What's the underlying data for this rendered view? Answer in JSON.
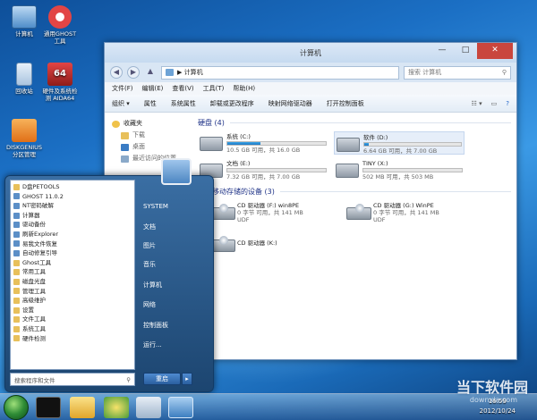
{
  "desktop": {
    "icons": [
      {
        "label": "计算机",
        "color": "#7aaee0"
      },
      {
        "label": "通用GHOST\n工具",
        "color": "#e24545"
      },
      {
        "label": "回收站",
        "color": "#c9dff3"
      },
      {
        "label": "硬件及系统检\n测 AIDA64",
        "color": "#c9312c"
      },
      {
        "label": "DISKGENIUS\n分区管理",
        "color": "#f08c2a"
      }
    ]
  },
  "window": {
    "title": "计算机",
    "nav": {
      "back": "◀",
      "forward": "▶",
      "up": "▲"
    },
    "address": "▶ 计算机",
    "search_placeholder": "搜索 计算机",
    "menu": [
      "文件(F)",
      "编辑(E)",
      "查看(V)",
      "工具(T)",
      "帮助(H)"
    ],
    "toolbar": [
      "组织 ▾",
      "属性",
      "系统属性",
      "卸载或更改程序",
      "映射网络驱动器",
      "打开控制面板"
    ],
    "sidebar": [
      {
        "label": "收藏夹",
        "sub": false
      },
      {
        "label": "下载",
        "sub": true
      },
      {
        "label": "桌面",
        "sub": true
      },
      {
        "label": "最近访问的位置",
        "sub": true
      }
    ],
    "hdd_heading": "硬盘 (4)",
    "drives": [
      {
        "name": "系统 (C:)",
        "info": "10.5 GB 可用，共 16.0 GB",
        "fill": 0.34,
        "sel": false
      },
      {
        "name": "软件 (D:)",
        "info": "6.64 GB 可用，共 7.00 GB",
        "fill": 0.05,
        "sel": true
      },
      {
        "name": "文档 (E:)",
        "info": "7.32 GB 可用，共 7.00 GB",
        "fill": 0.0,
        "sel": false
      },
      {
        "name": "TINY (X:)",
        "info": "502 MB 可用，共 503 MB",
        "fill": 0.0,
        "sel": false
      }
    ],
    "removable_heading": "有可移动存储的设备 (3)",
    "removables": [
      {
        "name": "CD 驱动器 (F:) win8PE",
        "line2": "0 字节 可用，共 141 MB",
        "line3": "UDF"
      },
      {
        "name": "CD 驱动器 (G:) WinPE",
        "line2": "0 字节 可用，共 141 MB",
        "line3": "UDF"
      },
      {
        "name": "CD 驱动器 (K:)",
        "line2": "",
        "line3": ""
      }
    ]
  },
  "start_menu": {
    "programs": [
      {
        "label": "D盘PETOOLS",
        "folder": true
      },
      {
        "label": "GHOST 11.0.2",
        "folder": false
      },
      {
        "label": "NT密码破解",
        "folder": false
      },
      {
        "label": "计算器",
        "folder": false
      },
      {
        "label": "驱动备份",
        "folder": false
      },
      {
        "label": "刷新Explorer",
        "folder": false
      },
      {
        "label": "易我文件恢复",
        "folder": false
      },
      {
        "label": "自动修复引导",
        "folder": false
      },
      {
        "label": "Ghost工具",
        "folder": true
      },
      {
        "label": "常用工具",
        "folder": true
      },
      {
        "label": "磁盘光盘",
        "folder": true
      },
      {
        "label": "管理工具",
        "folder": true
      },
      {
        "label": "高级维护",
        "folder": true
      },
      {
        "label": "设置",
        "folder": true
      },
      {
        "label": "文件工具",
        "folder": true
      },
      {
        "label": "系统工具",
        "folder": true
      },
      {
        "label": "硬件检测",
        "folder": true
      }
    ],
    "search_placeholder": "搜索程序和文件",
    "right_items": [
      "SYSTEM",
      "文档",
      "图片",
      "音乐",
      "计算机",
      "网络",
      "控制面板",
      "运行..."
    ],
    "shutdown_label": "重启"
  },
  "taskbar": {
    "time": "16:59",
    "date": "2012/10/24"
  },
  "watermark": {
    "text": "当下软件园",
    "sub": "downxia.com"
  }
}
